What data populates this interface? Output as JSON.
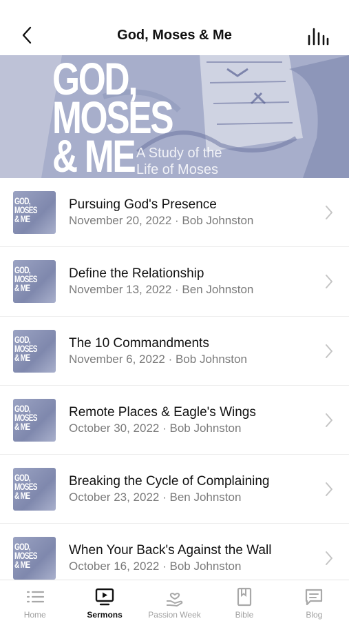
{
  "header": {
    "title": "God, Moses & Me"
  },
  "hero": {
    "title_lines": [
      "GOD,",
      "MOSES",
      "& ME"
    ],
    "subtitle_line1": "A Study of the",
    "subtitle_line2": "Life of Moses"
  },
  "thumb": {
    "lines": [
      "GOD,",
      "MOSES",
      "& ME"
    ]
  },
  "sermons": [
    {
      "title": "Pursuing God's Presence",
      "meta": "November 20, 2022 · Bob Johnston"
    },
    {
      "title": "Define the Relationship",
      "meta": "November 13, 2022 · Ben Johnston"
    },
    {
      "title": "The 10 Commandments",
      "meta": "November 6, 2022 · Bob Johnston"
    },
    {
      "title": "Remote Places & Eagle's Wings",
      "meta": "October 30, 2022 · Bob Johnston"
    },
    {
      "title": "Breaking the Cycle of Complaining",
      "meta": "October 23, 2022 · Ben Johnston"
    },
    {
      "title": "When Your Back's Against the Wall",
      "meta": "October 16, 2022 · Bob Johnston"
    }
  ],
  "tabs": [
    {
      "label": "Home",
      "icon": "list-icon",
      "active": false
    },
    {
      "label": "Sermons",
      "icon": "play-tv-icon",
      "active": true
    },
    {
      "label": "Passion Week",
      "icon": "hand-heart-icon",
      "active": false
    },
    {
      "label": "Bible",
      "icon": "book-icon",
      "active": false
    },
    {
      "label": "Blog",
      "icon": "message-icon",
      "active": false
    }
  ],
  "colors": {
    "hero_tint": "#9aa3c4",
    "inactive_tab": "#a0a0a0",
    "active_tab": "#111111",
    "meta_text": "#7a7a7a"
  }
}
